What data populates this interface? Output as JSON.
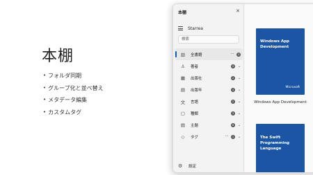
{
  "slide": {
    "title": "本棚",
    "features": [
      "フォルダ同期",
      "グループ化と並べ替え",
      "メタデータ編集",
      "カスタムタグ"
    ]
  },
  "window": {
    "title": "本棚",
    "app_name": "Starrea",
    "search_placeholder": "検索",
    "nav_items": [
      {
        "label": "全書籍",
        "icon": "library-icon",
        "glyph": "▥",
        "count": "4",
        "more": "···",
        "selected": true
      },
      {
        "label": "著者",
        "icon": "person-icon",
        "glyph": "♙",
        "count": "4",
        "chevron": "⌄"
      },
      {
        "label": "出版社",
        "icon": "building-icon",
        "glyph": "▦",
        "count": "2",
        "chevron": "⌄"
      },
      {
        "label": "出版年",
        "icon": "calendar-icon",
        "glyph": "▤",
        "count": "4",
        "chevron": "⌄"
      },
      {
        "label": "言語",
        "icon": "language-icon",
        "glyph": "文",
        "count": "2",
        "chevron": "⌄"
      },
      {
        "label": "種類",
        "icon": "folder-icon",
        "glyph": "▢",
        "count": "3",
        "chevron": "⌄"
      },
      {
        "label": "主題",
        "icon": "tag-list-icon",
        "glyph": "▤",
        "count": "6",
        "chevron": "⌄"
      },
      {
        "label": "タグ",
        "icon": "tag-icon",
        "glyph": "◇",
        "count": "1",
        "more": "···",
        "chevron": "⌄"
      }
    ],
    "settings_label": "設定",
    "close_glyph": "✕",
    "settings_glyph": "⚙"
  },
  "books": [
    {
      "cover_title": "Windows App Development",
      "publisher": "Microsoft",
      "caption": "Windows App Development",
      "color": "#1b55a3"
    },
    {
      "cover_title": "The Swift Programming Language",
      "publisher": "",
      "caption": "",
      "color": "#1b55a3"
    }
  ]
}
